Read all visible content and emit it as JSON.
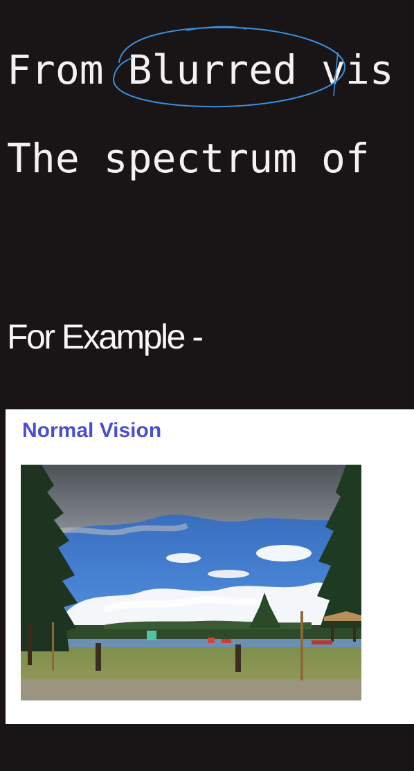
{
  "slide": {
    "line_1": "From Blurred vis",
    "line_2": "The spectrum of",
    "example_heading": "For Example -"
  },
  "figure": {
    "label": "Normal Vision",
    "label_color": "#4b4fcf"
  },
  "colors": {
    "background": "#191516",
    "text": "#f2f2f2",
    "annotation_ink": "#3a8fdc"
  }
}
